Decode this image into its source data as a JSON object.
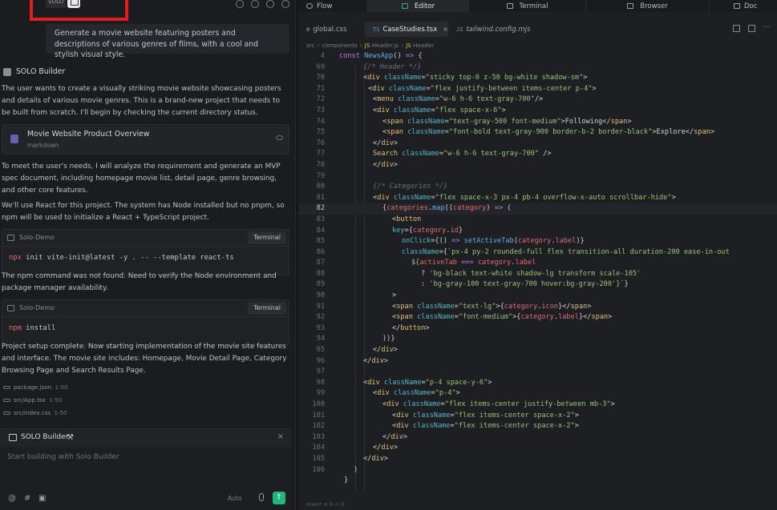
{
  "left": {
    "solo_chip": "SOLO",
    "prompt": "Generate a movie website featuring posters and descriptions of various genres of films, with a cool and stylish visual style.",
    "builder_name": "SOLO Builder",
    "intro": "The user wants to create a visually striking movie website showcasing posters and details of various movie genres. This is a brand-new project that needs to be built from scratch. I'll begin by checking the current directory status.",
    "doc_card": {
      "title": "Movie Website Product Overview",
      "type": "markdown"
    },
    "mvp_text": "To meet the user's needs, I will analyze the requirement and generate an MVP spec document, including homepage movie list, detail page, genre browsing, and other core features.",
    "react_text": "We'll use React for this project. The system has Node installed but no pnpm, so npm will be used to initialize a React + TypeScript project.",
    "term1": {
      "name": "Solo-Demo",
      "button": "Terminal",
      "cmd_kw": "npx",
      "cmd_rest": " init vite-init@latest -y . -- --template react-ts"
    },
    "npm_text": "The npm command was not found. Need to verify the Node environment and package manager availability.",
    "term2": {
      "name": "Solo-Demo",
      "button": "Terminal",
      "cmd_kw": "npm",
      "cmd_rest": " install"
    },
    "setup_text": "Project setup complete. Now starting implementation of the movie site features and interface. The movie site includes: Homepage, Movie Detail Page, Category Browsing Page and Search Results Page.",
    "files": [
      {
        "name": "package.json",
        "lines": "1-50"
      },
      {
        "name": "src/App.tsx",
        "lines": "1-50"
      },
      {
        "name": "src/index.css",
        "lines": "1-50"
      }
    ],
    "composer": {
      "title": "SOLO Builder",
      "placeholder": "Start building with Solo Builder",
      "mode": "Auto"
    }
  },
  "tabs": [
    "Flow",
    "Editor",
    "Terminal",
    "Browser",
    "Doc"
  ],
  "file_tabs": [
    {
      "label": "global.css",
      "icon": "#"
    },
    {
      "label": "CaseStudies.tsx",
      "icon": "TS",
      "close": "×"
    },
    {
      "label": "tailwind.config.mjs",
      "icon": "JS"
    }
  ],
  "breadcrumb": [
    "src",
    "components",
    "Header.js",
    "Header"
  ],
  "breadcrumb_icon": "JS",
  "code": {
    "numbers": [
      "4",
      "69",
      "70",
      "71",
      "72",
      "73",
      "74",
      "75",
      "76",
      "77",
      "78",
      "79",
      "80",
      "81",
      "82",
      "83",
      "84",
      "85",
      "86",
      "87",
      "88",
      "89",
      "90",
      "91",
      "92",
      "93",
      "94",
      "95",
      "96",
      "97",
      "98",
      "99",
      "100",
      "101",
      "102",
      "103",
      "104",
      "105",
      "106"
    ]
  },
  "status_bar": "main*  ⊘ 0 ⚠ 0"
}
